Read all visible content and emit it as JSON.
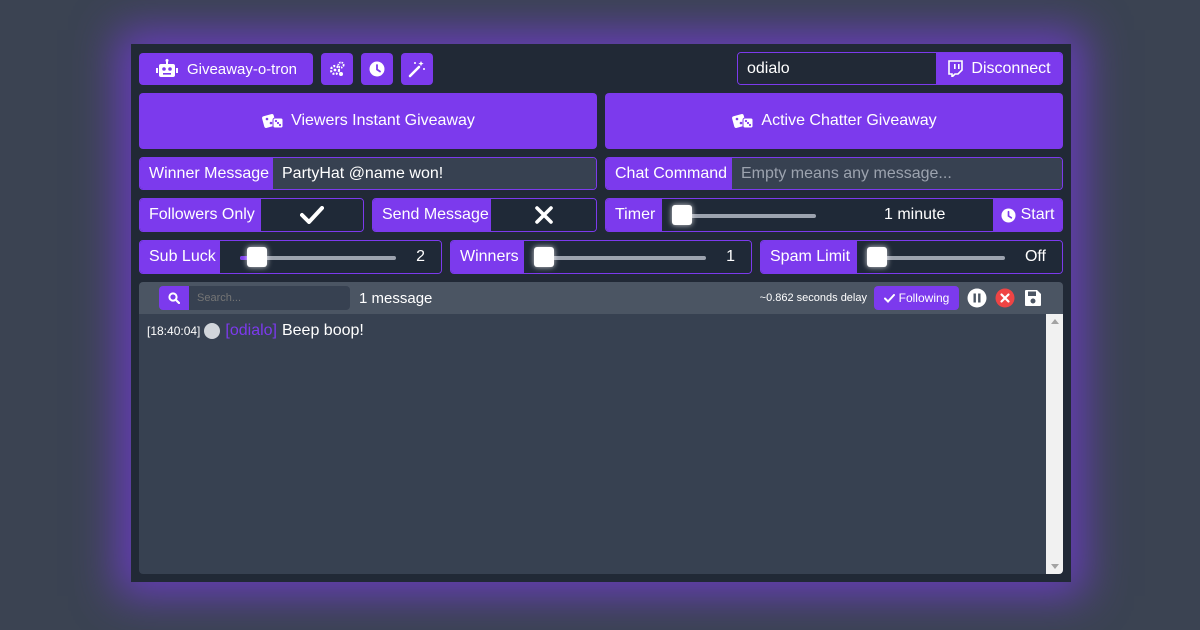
{
  "header": {
    "app_title": "Giveaway-o-tron",
    "channel_value": "odialo",
    "disconnect_label": "Disconnect"
  },
  "giveaways": {
    "viewers_label": "Viewers Instant Giveaway",
    "chatter_label": "Active Chatter Giveaway"
  },
  "winner_message": {
    "label": "Winner Message",
    "value": "PartyHat @name won!"
  },
  "chat_command": {
    "label": "Chat Command",
    "value": "",
    "placeholder": "Empty means any message..."
  },
  "followers_only": {
    "label": "Followers Only",
    "enabled": true
  },
  "send_message": {
    "label": "Send Message",
    "enabled": false
  },
  "timer": {
    "label": "Timer",
    "value_label": "1 minute",
    "start_label": "Start",
    "fraction": 0.0
  },
  "sub_luck": {
    "label": "Sub Luck",
    "value": "2",
    "fraction": 0.1
  },
  "winners": {
    "label": "Winners",
    "value": "1",
    "fraction": 0.0
  },
  "spam_limit": {
    "label": "Spam Limit",
    "value": "Off",
    "fraction": 0.0
  },
  "chat": {
    "search_placeholder": "Search...",
    "message_count": "1 message",
    "delay_text": "~0.862 seconds delay",
    "following_label": "Following",
    "messages": [
      {
        "time": "[18:40:04]",
        "user": "[odialo]",
        "text": "Beep boop!"
      }
    ]
  },
  "colors": {
    "accent": "#7c3aed",
    "panel": "#212936",
    "field": "#374151",
    "username": "#7c3aed",
    "clear_icon": "#ef4444"
  },
  "icons": [
    "robot-icon",
    "gears-icon",
    "clock-icon",
    "magic-wand-icon",
    "twitch-icon",
    "dice-icon",
    "check-icon",
    "x-icon",
    "search-icon",
    "pause-icon",
    "clear-icon",
    "save-icon"
  ]
}
